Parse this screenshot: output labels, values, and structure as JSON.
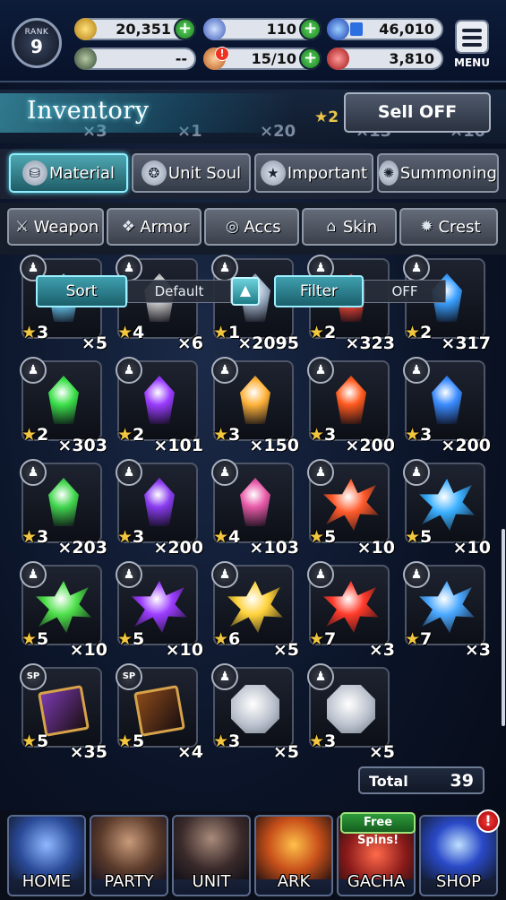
{
  "topbar": {
    "rank_label": "RANK",
    "rank_value": "9",
    "gil": "20,351",
    "lapis": "110",
    "exp": "46,010",
    "vision": "--",
    "stamina": "15/10",
    "arena": "3,810",
    "stamina_alert": "!",
    "menu_label": "MENU"
  },
  "inventory": {
    "title": "Inventory",
    "sell_off_label": "Sell OFF",
    "behind_counts": [
      "×3",
      "×1",
      "×20",
      "×13",
      "×10"
    ],
    "behind_star": "★2"
  },
  "tabs": [
    {
      "label": "Material",
      "icon": "bag-icon",
      "active": true
    },
    {
      "label": "Unit Soul",
      "icon": "soul-icon",
      "active": false
    },
    {
      "label": "Important",
      "icon": "star-icon",
      "active": false
    },
    {
      "label": "Summoning",
      "icon": "esper-icon",
      "active": false
    }
  ],
  "subtabs": [
    {
      "label": "Weapon",
      "icon": "sword-icon"
    },
    {
      "label": "Armor",
      "icon": "armor-icon"
    },
    {
      "label": "Accs",
      "icon": "ring-icon"
    },
    {
      "label": "Skin",
      "icon": "hanger-icon"
    },
    {
      "label": "Crest",
      "icon": "crest-icon"
    }
  ],
  "sort_filter": {
    "sort_label": "Sort",
    "sort_value": "Default",
    "filter_label": "Filter",
    "filter_value": "OFF"
  },
  "items": [
    {
      "rarity": "3",
      "qty": "×5",
      "color": "#6fd3ff",
      "shape": "gem"
    },
    {
      "rarity": "4",
      "qty": "×6",
      "color": "#c8c8c8",
      "shape": "gem"
    },
    {
      "rarity": "1",
      "qty": "×2095",
      "color": "#9fb2c8",
      "shape": "gem"
    },
    {
      "rarity": "2",
      "qty": "×323",
      "color": "#ff4a3a",
      "shape": "gem"
    },
    {
      "rarity": "2",
      "qty": "×317",
      "color": "#3aa0ff",
      "shape": "gem"
    },
    {
      "rarity": "2",
      "qty": "×303",
      "color": "#3be04a",
      "shape": "gem"
    },
    {
      "rarity": "2",
      "qty": "×101",
      "color": "#9a3cff",
      "shape": "gem"
    },
    {
      "rarity": "3",
      "qty": "×150",
      "color": "#ffb23a",
      "shape": "gem"
    },
    {
      "rarity": "3",
      "qty": "×200",
      "color": "#ff5a1e",
      "shape": "gem"
    },
    {
      "rarity": "3",
      "qty": "×200",
      "color": "#3a8bff",
      "shape": "gem"
    },
    {
      "rarity": "3",
      "qty": "×203",
      "color": "#42d64e",
      "shape": "gem"
    },
    {
      "rarity": "3",
      "qty": "×200",
      "color": "#8a3cf0",
      "shape": "gem"
    },
    {
      "rarity": "4",
      "qty": "×103",
      "color": "#e85aa8",
      "shape": "gem"
    },
    {
      "rarity": "5",
      "qty": "×10",
      "color": "#ff5a2a",
      "shape": "cluster"
    },
    {
      "rarity": "5",
      "qty": "×10",
      "color": "#3ab0ff",
      "shape": "cluster"
    },
    {
      "rarity": "5",
      "qty": "×10",
      "color": "#4ee04a",
      "shape": "cluster"
    },
    {
      "rarity": "5",
      "qty": "×10",
      "color": "#9c3cff",
      "shape": "cluster"
    },
    {
      "rarity": "6",
      "qty": "×5",
      "color": "#ffd23a",
      "shape": "cluster"
    },
    {
      "rarity": "7",
      "qty": "×3",
      "color": "#ff3a2a",
      "shape": "cluster"
    },
    {
      "rarity": "7",
      "qty": "×3",
      "color": "#4aa8ff",
      "shape": "cluster"
    },
    {
      "rarity": "5",
      "qty": "×35",
      "color": "#7a3ab0",
      "shape": "book"
    },
    {
      "rarity": "5",
      "qty": "×4",
      "color": "#8a4a1a",
      "shape": "book"
    },
    {
      "rarity": "3",
      "qty": "×5",
      "color": "#c8ccd4",
      "shape": "crest"
    },
    {
      "rarity": "3",
      "qty": "×5",
      "color": "#c8ccd4",
      "shape": "crest"
    }
  ],
  "total": {
    "label": "Total",
    "value": "39"
  },
  "nav": [
    {
      "label": "HOME",
      "color": "#3a6fc8"
    },
    {
      "label": "PARTY",
      "color": "#6a4a3a"
    },
    {
      "label": "UNIT",
      "color": "#3a2a2a"
    },
    {
      "label": "ARK",
      "color": "#c85a1a"
    },
    {
      "label": "GACHA",
      "color": "#9a2a2a"
    },
    {
      "label": "SHOP",
      "color": "#2a4ac8"
    }
  ],
  "free_spins": "Free Spins!",
  "shop_alert": "!"
}
